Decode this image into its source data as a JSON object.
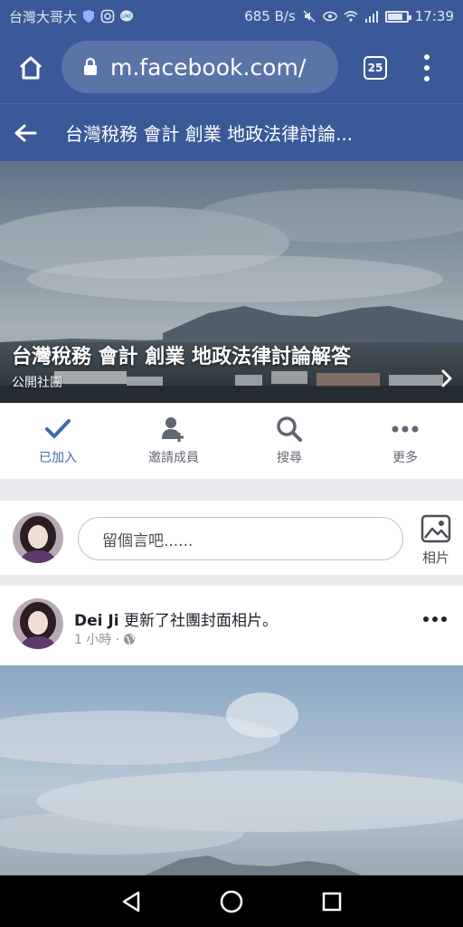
{
  "status_bar": {
    "carrier": "台灣大哥大",
    "network_speed": "685 B/s",
    "time": "17:39"
  },
  "browser": {
    "url": "m.facebook.com/",
    "tab_count": "25"
  },
  "header": {
    "title": "台灣稅務 會計 創業 地政法律討論..."
  },
  "cover": {
    "group_name": "台灣稅務 會計 創業 地政法律討論解答",
    "privacy": "公開社團"
  },
  "actions": [
    {
      "label": "已加入",
      "icon": "check-icon"
    },
    {
      "label": "邀請成員",
      "icon": "add-person-icon"
    },
    {
      "label": "搜尋",
      "icon": "search-icon"
    },
    {
      "label": "更多",
      "icon": "more-icon"
    }
  ],
  "composer": {
    "placeholder": "留個言吧......",
    "photo_label": "相片"
  },
  "post": {
    "author": "Dei Ji",
    "action_text": "更新了社團封面相片。",
    "time": "1 小時 ·"
  },
  "colors": {
    "brand": "#3b5998",
    "accent": "#4267b2"
  }
}
